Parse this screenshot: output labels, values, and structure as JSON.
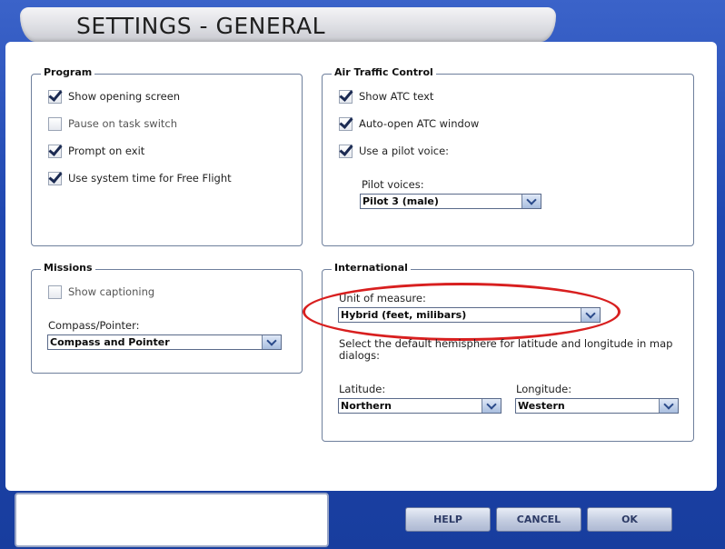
{
  "window": {
    "title": "SETTINGS - GENERAL"
  },
  "program": {
    "legend": "Program",
    "options": [
      {
        "label": "Show opening screen",
        "checked": true
      },
      {
        "label": "Pause on task switch",
        "checked": false
      },
      {
        "label": "Prompt on exit",
        "checked": true
      },
      {
        "label": "Use system time for Free Flight",
        "checked": true
      }
    ]
  },
  "atc": {
    "legend": "Air Traffic Control",
    "options": [
      {
        "label": "Show ATC text",
        "checked": true
      },
      {
        "label": "Auto-open ATC window",
        "checked": true
      },
      {
        "label": "Use a pilot voice:",
        "checked": true
      }
    ],
    "pilot_voices_label": "Pilot voices:",
    "pilot_voices_value": "Pilot 3 (male)"
  },
  "missions": {
    "legend": "Missions",
    "show_captioning_label": "Show captioning",
    "show_captioning_checked": false,
    "compass_label": "Compass/Pointer:",
    "compass_value": "Compass and Pointer"
  },
  "international": {
    "legend": "International",
    "unit_label": "Unit of measure:",
    "unit_value": "Hybrid (feet, milibars)",
    "hemisphere_hint": "Select the default hemisphere for latitude and longitude in map dialogs:",
    "latitude_label": "Latitude:",
    "latitude_value": "Northern",
    "longitude_label": "Longitude:",
    "longitude_value": "Western"
  },
  "buttons": {
    "help": "HELP",
    "cancel": "CANCEL",
    "ok": "OK"
  },
  "colors": {
    "frame": "#1f47b0",
    "highlight": "#d81f1f",
    "panel": "#ffffff"
  }
}
